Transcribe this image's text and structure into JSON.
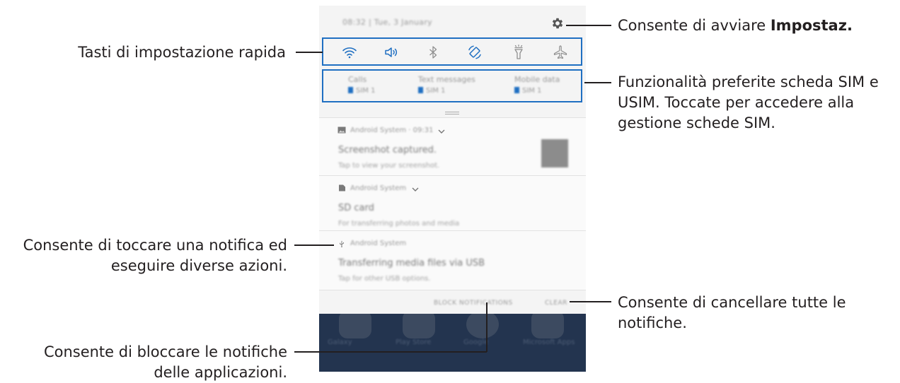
{
  "phone": {
    "status": {
      "time_date": "08:32 | Tue, 3 January"
    },
    "quick_settings": [
      {
        "name": "wifi-icon",
        "active": true
      },
      {
        "name": "sound-icon",
        "active": true
      },
      {
        "name": "bluetooth-icon",
        "active": false
      },
      {
        "name": "auto-rotate-icon",
        "active": true
      },
      {
        "name": "flashlight-icon",
        "active": false
      },
      {
        "name": "airplane-icon",
        "active": false
      }
    ],
    "sim": {
      "calls": {
        "label": "Calls",
        "value": "SIM 1"
      },
      "text": {
        "label": "Text messages",
        "value": "SIM 1"
      },
      "data": {
        "label": "Mobile data",
        "value": "SIM 1"
      }
    },
    "notifications": [
      {
        "app": "Android System · 09:31",
        "title": "Screenshot captured.",
        "desc": "Tap to view your screenshot."
      },
      {
        "app": "Android System",
        "title": "SD card",
        "desc": "For transferring photos and media"
      },
      {
        "app": "Android System",
        "title": "Transferring media files via USB",
        "desc": "Tap for other USB options."
      }
    ],
    "actions": {
      "block": "BLOCK NOTIFICATIONS",
      "clear": "CLEAR"
    },
    "home_apps": [
      "Galaxy",
      "Play Store",
      "Google",
      "Microsoft Apps"
    ]
  },
  "annotations": {
    "quick_settings": "Tasti di impostazione rapida",
    "settings_prefix": "Consente di avviare ",
    "settings_bold": "Impostaz.",
    "sim_line1": "Funzionalità preferite scheda SIM e",
    "sim_line2": "USIM. Toccate per accedere alla",
    "sim_line3": "gestione schede SIM.",
    "notif_line1": "Consente di toccare una notifica ed",
    "notif_line2": "eseguire diverse azioni.",
    "clear_line1": "Consente di cancellare tutte le",
    "clear_line2": "notifiche.",
    "block_line1": "Consente di bloccare le notifiche",
    "block_line2": "delle applicazioni."
  },
  "colors": {
    "accent": "#1f6fc2",
    "text": "#231f20",
    "home_bg": "#23344f"
  }
}
